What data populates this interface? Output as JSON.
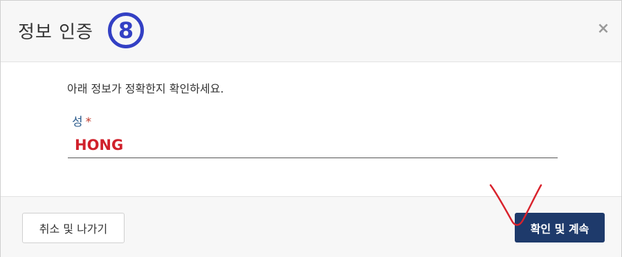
{
  "dialog": {
    "title": "정보 인증",
    "step_number": "8",
    "close_symbol": "×"
  },
  "body": {
    "instruction": "아래 정보가 정확한지 확인하세요.",
    "field": {
      "label": "성",
      "required_marker": "*",
      "value": "HONG"
    }
  },
  "footer": {
    "cancel_label": "취소 및 나가기",
    "confirm_label": "확인 및 계속"
  },
  "annotation": {
    "type": "hand-drawn checkmark",
    "color": "#d9232d"
  },
  "colors": {
    "step_badge": "#3340c4",
    "field_label": "#2b5b8c",
    "input_value": "#d0212b",
    "confirm_button": "#1e3a6b"
  }
}
